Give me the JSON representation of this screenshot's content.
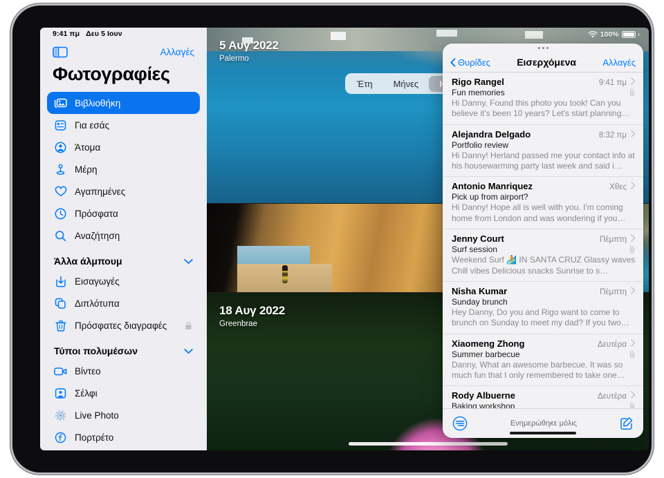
{
  "device": {
    "type": "tablet"
  },
  "status_bar": {
    "time": "9:41 πμ",
    "date": "Δευ 5 Ιουν",
    "battery_percent": "100%",
    "wifi_icon": "wifi-icon",
    "battery_icon": "battery-icon"
  },
  "sidebar": {
    "toggle_icon": "sidebar-toggle-icon",
    "edit_label": "Αλλαγές",
    "title": "Φωτογραφίες",
    "items": [
      {
        "label": "Βιβλιοθήκη",
        "icon": "photo-library-icon",
        "selected": true
      },
      {
        "label": "Για εσάς",
        "icon": "for-you-icon",
        "selected": false
      },
      {
        "label": "Άτομα",
        "icon": "people-icon",
        "selected": false
      },
      {
        "label": "Μέρη",
        "icon": "places-pin-icon",
        "selected": false
      },
      {
        "label": "Αγαπημένες",
        "icon": "heart-icon",
        "selected": false
      },
      {
        "label": "Πρόσφατα",
        "icon": "clock-icon",
        "selected": false
      },
      {
        "label": "Αναζήτηση",
        "icon": "search-icon",
        "selected": false
      }
    ],
    "groups": [
      {
        "title": "Άλλα άλμπουμ",
        "chevron_icon": "chevron-down-icon",
        "items": [
          {
            "label": "Εισαγωγές",
            "icon": "import-icon",
            "trailing_icon": ""
          },
          {
            "label": "Διπλότυπα",
            "icon": "duplicates-icon",
            "trailing_icon": ""
          },
          {
            "label": "Πρόσφατες διαγραφές",
            "icon": "trash-icon",
            "trailing_icon": "lock-icon"
          }
        ]
      },
      {
        "title": "Τύποι πολυμέσων",
        "chevron_icon": "chevron-down-icon",
        "items": [
          {
            "label": "Βίντεο",
            "icon": "video-icon",
            "trailing_icon": ""
          },
          {
            "label": "Σέλφι",
            "icon": "selfie-icon",
            "trailing_icon": ""
          },
          {
            "label": "Live Photo",
            "icon": "live-photo-icon",
            "trailing_icon": ""
          },
          {
            "label": "Πορτρέτο",
            "icon": "portrait-icon",
            "trailing_icon": ""
          }
        ]
      }
    ]
  },
  "segmented_control": {
    "options": [
      "Έτη",
      "Μήνες",
      "Ημέρες"
    ],
    "selected": "Ημέρες"
  },
  "photo_groups": [
    {
      "date": "5 Αυγ 2022",
      "place": "Palermo"
    },
    {
      "date": "18 Αυγ 2022",
      "place": "Greenbrae"
    }
  ],
  "mail_panel": {
    "grabber_icon": "grabber-dots-icon",
    "back_label": "Θυρίδες",
    "back_icon": "chevron-left-icon",
    "title": "Εισερχόμενα",
    "edit_label": "Αλλαγές",
    "messages": [
      {
        "sender": "Rigo Rangel",
        "time": "9:41 πμ",
        "subject": "Fun memories",
        "preview": "Hi Danny, Found this photo you took! Can you believe it's been 10 years? Let's start planning…",
        "attachment": true
      },
      {
        "sender": "Alejandra Delgado",
        "time": "8:32 πμ",
        "subject": "Portfolio review",
        "preview": "Hi Danny! Herland passed me your contact info at his housewarming party last week and said i…",
        "attachment": false
      },
      {
        "sender": "Antonio Manriquez",
        "time": "Χθες",
        "subject": "Pick up from airport?",
        "preview": "Hi Danny! Hope all is well with you. I'm coming home from London and was wondering if you…",
        "attachment": false
      },
      {
        "sender": "Jenny Court",
        "time": "Πέμπτη",
        "subject": "Surf session",
        "preview": "Weekend Surf 🏄 IN SANTA CRUZ Glassy waves Chill vibes Delicious snacks Sunrise to s…",
        "attachment": true
      },
      {
        "sender": "Nisha Kumar",
        "time": "Πέμπτη",
        "subject": "Sunday brunch",
        "preview": "Hey Danny, Do you and Rigo want to come to brunch on Sunday to meet my dad? If you two…",
        "attachment": false
      },
      {
        "sender": "Xiaomeng Zhong",
        "time": "Δευτέρα",
        "subject": "Summer barbecue",
        "preview": "Danny, What an awesome barbecue. It was so much fun that I only remembered to take one…",
        "attachment": true
      },
      {
        "sender": "Rody Albuerne",
        "time": "Δευτέρα",
        "subject": "Baking workshop",
        "preview": "",
        "attachment": true
      }
    ],
    "toolbar": {
      "filter_icon": "filter-icon",
      "status": "Ενημερώθηκε μόλις",
      "compose_icon": "compose-icon"
    }
  },
  "colors": {
    "accent": "#007aff",
    "selected_row": "#0a74ef",
    "sidebar_bg": "#ededf2",
    "panel_bg": "#f2f2f5"
  }
}
